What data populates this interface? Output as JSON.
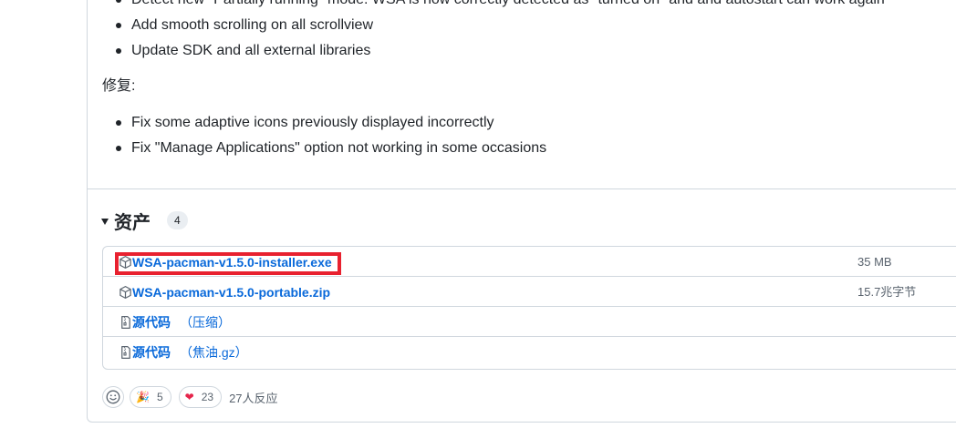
{
  "release_notes": {
    "feature_items": [
      "Detect new \"Partially running\" mode: WSA is now correctly detected as \"turned on\" and and autostart can work again",
      "Add smooth scrolling on all scrollview",
      "Update SDK and all external libraries"
    ],
    "fix_label": "修复:",
    "fix_items": [
      "Fix some adaptive icons previously displayed incorrectly",
      "Fix \"Manage Applications\" option not working in some occasions"
    ]
  },
  "assets": {
    "title": "资产",
    "count": "4",
    "items": [
      {
        "icon": "package-icon",
        "name": "WSA-pacman-v1.5.0-installer.exe",
        "suffix": "",
        "size": "35 MB"
      },
      {
        "icon": "package-icon",
        "name": "WSA-pacman-v1.5.0-portable.zip",
        "suffix": "",
        "size": "15.7兆字节"
      },
      {
        "icon": "file-zip-icon",
        "name": "源代码",
        "suffix": "（压缩）",
        "size": ""
      },
      {
        "icon": "file-zip-icon",
        "name": "源代码",
        "suffix": "（焦油.gz）",
        "size": ""
      }
    ]
  },
  "reactions": {
    "add_icon": "smiley-icon",
    "items": [
      {
        "emoji": "🎉",
        "icon": "tada-icon",
        "count": "5"
      },
      {
        "emoji": "❤",
        "icon": "heart-icon",
        "count": "23"
      }
    ],
    "summary": "27人反应"
  },
  "colors": {
    "link": "#0969da",
    "highlight": "#e8212f",
    "border": "#d0d7de",
    "muted": "#59636e"
  }
}
